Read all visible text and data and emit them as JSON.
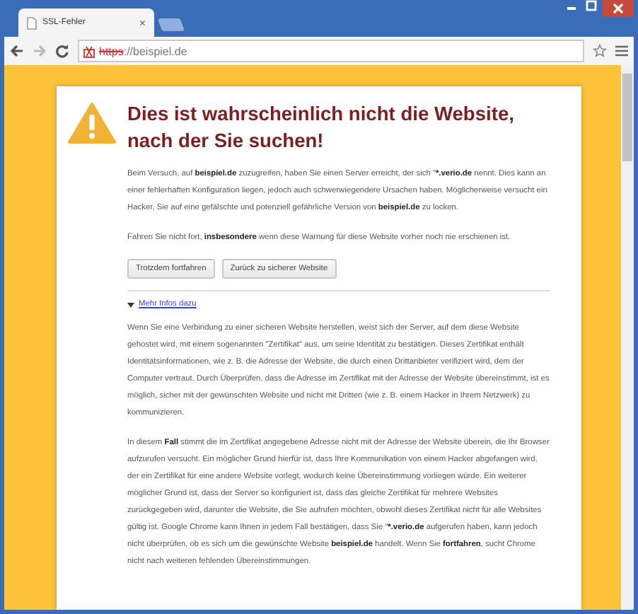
{
  "tab": {
    "title": "SSL-Fehler",
    "close": "×"
  },
  "address": {
    "scheme": "https",
    "rest": "://beispiel.de"
  },
  "heading": "Dies ist wahrscheinlich nicht die Website, nach der Sie suchen!",
  "intro": [
    [
      {
        "text": "Beim Versuch, auf ",
        "bold": false
      },
      {
        "text": "beispiel.de",
        "bold": true
      },
      {
        "text": " zuzugreifen, haben Sie einen Server erreicht, der sich \"",
        "bold": false
      },
      {
        "text": "*.verio.de",
        "bold": true
      },
      {
        "text": " nennt. Dies kann an einer fehlerhaften Konfiguration liegen, jedoch auch schwerwiegendere Ursachen haben. Möglicherweise versucht ein Hacker, Sie auf eine gefälschte und potenziell gefährliche Version von ",
        "bold": false
      },
      {
        "text": "beispiel.de",
        "bold": true
      },
      {
        "text": " zu locken.",
        "bold": false
      }
    ],
    [
      {
        "text": "Fahren Sie nicht fort, ",
        "bold": false
      },
      {
        "text": "insbesondere",
        "bold": true
      },
      {
        "text": " wenn diese Warnung für diese Website vorher noch nie erschienen ist.",
        "bold": false
      }
    ]
  ],
  "buttons": [
    "Trotzdem fortfahren",
    "Zurück zu sicherer Website"
  ],
  "more": {
    "label": "Mehr Infos dazu",
    "expanded": true
  },
  "details": [
    [
      {
        "text": "Wenn Sie eine Verbindung zu einer sicheren Website herstellen, weist sich der Server, auf dem diese Website gehostet wird, mit einem sogenannten \"Zertifikat\" aus, um seine Identität zu bestätigen. Dieses Zertifikat enthält Identitätsinformationen, wie z. B. die Adresse der Website, die durch einen Drittanbieter verifiziert wird, dem der Computer vertraut. Durch Überprüfen, dass die Adresse im Zertifikat mit der Adresse der Website übereinstimmt, ist es möglich, sicher mit der gewünschten Website und nicht mit Dritten (wie z. B. einem Hacker in Ihrem Netzwerk) zu kommunizieren.",
        "bold": false
      }
    ],
    [
      {
        "text": "In diesem ",
        "bold": false
      },
      {
        "text": "Fall",
        "bold": true
      },
      {
        "text": " stimmt die im Zertifikat angegebene Adresse nicht mit der Adresse der Website überein, die Ihr Browser aufzurufen versucht. Ein möglicher Grund hierfür ist, dass Ihre Kommunikation von einem Hacker abgefangen wird, der ein Zertifikat für eine andere Website vorlegt, wodurch keine Übereinstimmung vorliegen würde. Ein weiterer möglicher Grund ist, dass der Server so konfiguriert ist, dass das gleiche Zertifikat für mehrere Websites zurückgegeben wird, darunter die Website, die Sie aufrufen möchten, obwohl dieses Zertifikat nicht für alle Websites gültig ist. Google Chrome kann Ihnen in jedem Fall bestätigen, dass Sie \"",
        "bold": false
      },
      {
        "text": "*.verio.de",
        "bold": true
      },
      {
        "text": " aufgerufen haben, kann jedoch nicht überprüfen, ob es sich um die gewünschte Website ",
        "bold": false
      },
      {
        "text": "beispiel.de",
        "bold": true
      },
      {
        "text": " handelt. Wenn Sie ",
        "bold": false
      },
      {
        "text": "fortfahren",
        "bold": true
      },
      {
        "text": ", sucht Chrome nicht nach weiteren fehlenden Übereinstimmungen.",
        "bold": false
      }
    ]
  ]
}
